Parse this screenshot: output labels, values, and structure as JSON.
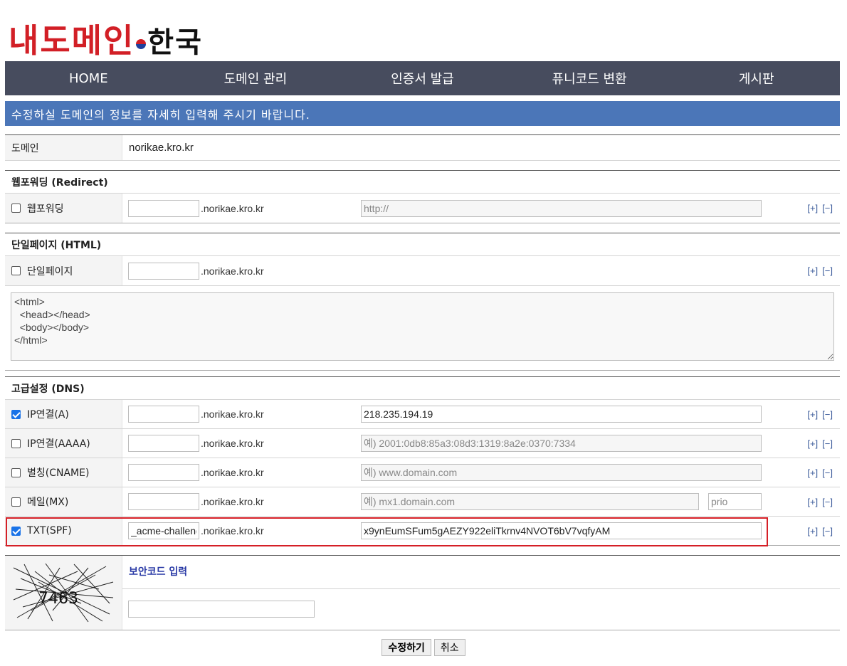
{
  "logo": {
    "part1": "내도메인",
    "part2": "한국"
  },
  "nav": [
    {
      "label": "HOME"
    },
    {
      "label": "도메인 관리"
    },
    {
      "label": "인증서 발급"
    },
    {
      "label": "퓨니코드 변환"
    },
    {
      "label": "게시판"
    }
  ],
  "banner": "수정하실 도메인의 정보를 자세히 입력해 주시기 바랍니다.",
  "domain": {
    "label": "도메인",
    "value": "norikae.kro.kr"
  },
  "suffix": ".norikae.kro.kr",
  "plus": "[+]",
  "minus": "[−]",
  "redirect": {
    "title": "웹포워딩 (Redirect)",
    "label": "웹포워딩",
    "checked": false,
    "sub_value": "",
    "url_placeholder": "http://"
  },
  "html_page": {
    "title": "단일페이지 (HTML)",
    "label": "단일페이지",
    "checked": false,
    "sub_value": "",
    "content": "<html>\n  <head></head>\n  <body></body>\n</html>"
  },
  "dns": {
    "title": "고급설정 (DNS)",
    "rows": [
      {
        "label": "IP연결(A)",
        "checked": true,
        "sub_value": "",
        "value": "218.235.194.19",
        "placeholder": ""
      },
      {
        "label": "IP연결(AAAA)",
        "checked": false,
        "sub_value": "",
        "value": "",
        "placeholder": "예) 2001:0db8:85a3:08d3:1319:8a2e:0370:7334"
      },
      {
        "label": "별칭(CNAME)",
        "checked": false,
        "sub_value": "",
        "value": "",
        "placeholder": "예) www.domain.com"
      },
      {
        "label": "메일(MX)",
        "checked": false,
        "sub_value": "",
        "value": "",
        "placeholder": "예) mx1.domain.com",
        "prio_placeholder": "prio"
      },
      {
        "label": "TXT(SPF)",
        "checked": true,
        "sub_value": "_acme-challenge",
        "value": "x9ynEumSFum5gAEZY922eliTkrnv4NVOT6bV7vqfyAM",
        "placeholder": ""
      }
    ]
  },
  "security": {
    "title": "보안코드 입력",
    "captcha_text": "7463",
    "input_value": ""
  },
  "buttons": {
    "submit": "수정하기",
    "cancel": "취소"
  },
  "colors": {
    "nav_bg": "#474c5e",
    "banner_bg": "#4b76b8",
    "highlight": "#d51f26"
  }
}
